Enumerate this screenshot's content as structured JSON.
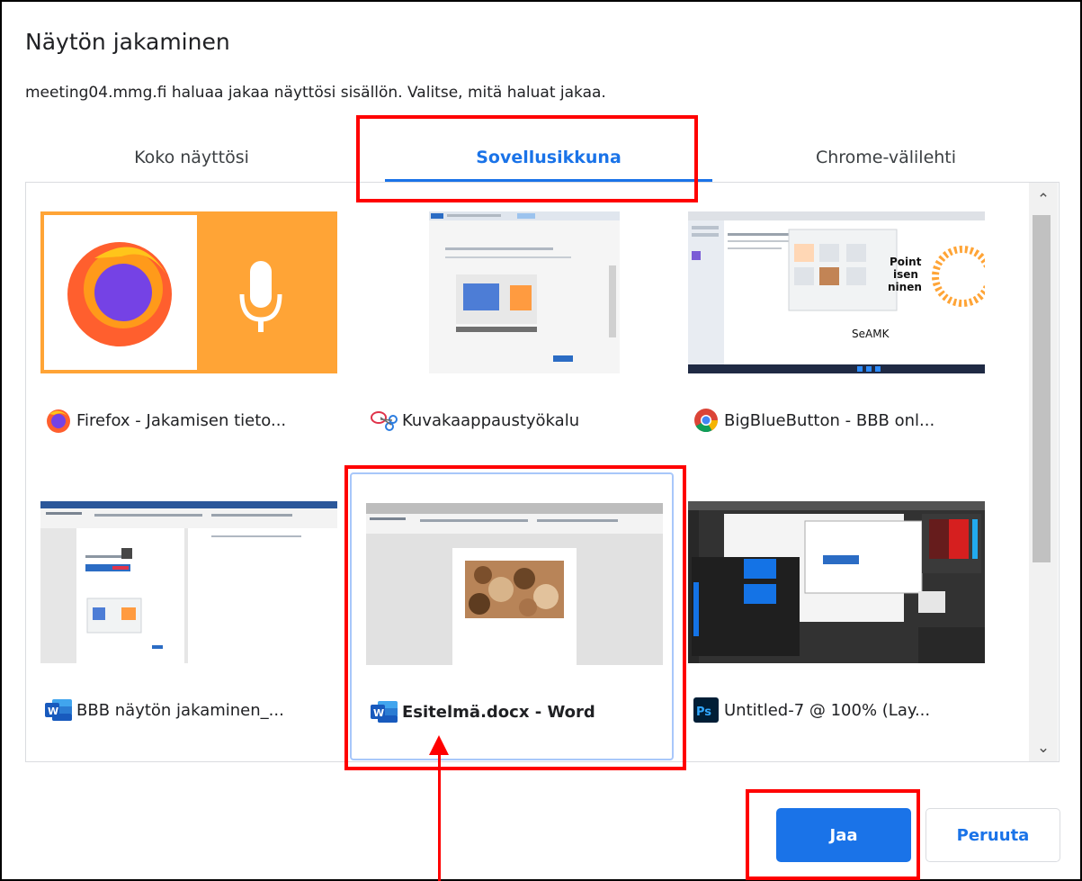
{
  "dialog": {
    "title": "Näytön jakaminen",
    "subtitle": "meeting04.mmg.fi haluaa jakaa näyttösi sisällön. Valitse, mitä haluat jakaa."
  },
  "tabs": [
    {
      "label": "Koko näyttösi"
    },
    {
      "label": "Sovellusikkuna",
      "active": true
    },
    {
      "label": "Chrome-välilehti"
    }
  ],
  "windows": [
    {
      "label": "Firefox - Jakamisen tieto...",
      "icon": "firefox-icon"
    },
    {
      "label": "Kuvakaappaustyökalu",
      "icon": "snipping-tool-icon"
    },
    {
      "label": "BigBlueButton - BBB onl...",
      "icon": "chrome-icon"
    },
    {
      "label": "BBB näytön jakaminen_...",
      "icon": "word-icon"
    },
    {
      "label": "Esitelmä.docx - Word",
      "icon": "word-icon",
      "selected": true
    },
    {
      "label": "Untitled-7 @ 100% (Lay...",
      "icon": "photoshop-icon"
    }
  ],
  "thumb_texts": {
    "seamk": "SeAMK",
    "point_lines": [
      "Point",
      "isen",
      "ninen"
    ]
  },
  "buttons": {
    "share": "Jaa",
    "cancel": "Peruuta"
  },
  "colors": {
    "accent": "#1a73e8",
    "highlight": "#ff0000",
    "firefox_orange": "#ffa436",
    "word_blue": "#185abd",
    "photoshop_bg": "#001e36",
    "photoshop_fg": "#31a8ff"
  }
}
